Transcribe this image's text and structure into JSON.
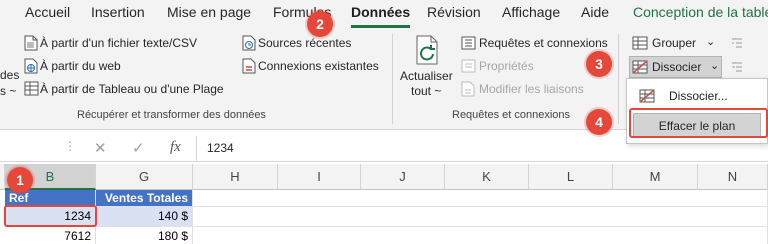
{
  "tabs": [
    {
      "label": "Accueil"
    },
    {
      "label": "Insertion"
    },
    {
      "label": "Mise en page"
    },
    {
      "label": "Formules"
    },
    {
      "label": "Données"
    },
    {
      "label": "Révision"
    },
    {
      "label": "Affichage"
    },
    {
      "label": "Aide"
    },
    {
      "label": "Conception de la table"
    }
  ],
  "ribbon": {
    "group1": {
      "clipped_text_1": "des",
      "clipped_text_2": "s ~",
      "from_text": "À partir d'un fichier texte/CSV",
      "from_web": "À partir du web",
      "from_table": "À partir de Tableau ou d'une Plage",
      "recent_sources": "Sources récentes",
      "existing_connections": "Connexions existantes",
      "label": "Récupérer et transformer des données"
    },
    "group2": {
      "refresh_label_1": "Actualiser",
      "refresh_label_2": "tout ~",
      "queries_connections": "Requêtes et connexions",
      "properties": "Propriétés",
      "edit_links": "Modifier les liaisons",
      "label": "Requêtes et connexions"
    },
    "group3": {
      "group_label": "Grouper",
      "ungroup_label": "Dissocier"
    }
  },
  "menu": {
    "items": [
      {
        "label": "Dissocier..."
      },
      {
        "label": "Effacer le plan"
      }
    ]
  },
  "formula_bar": {
    "fx": "fx",
    "value": "1234"
  },
  "grid": {
    "columns": [
      "B",
      "G",
      "H",
      "I",
      "J",
      "K",
      "L",
      "M",
      "N"
    ],
    "header_row": [
      "Ref",
      "Ventes Totales"
    ],
    "rows": [
      [
        "1234",
        "140 $"
      ],
      [
        "7612",
        "180 $"
      ]
    ]
  },
  "callouts": [
    "1",
    "2",
    "3",
    "4"
  ],
  "colors": {
    "accent": "#217346",
    "callout": "#e6473b",
    "table_header": "#4472c4",
    "table_band": "#d9e1f2"
  }
}
